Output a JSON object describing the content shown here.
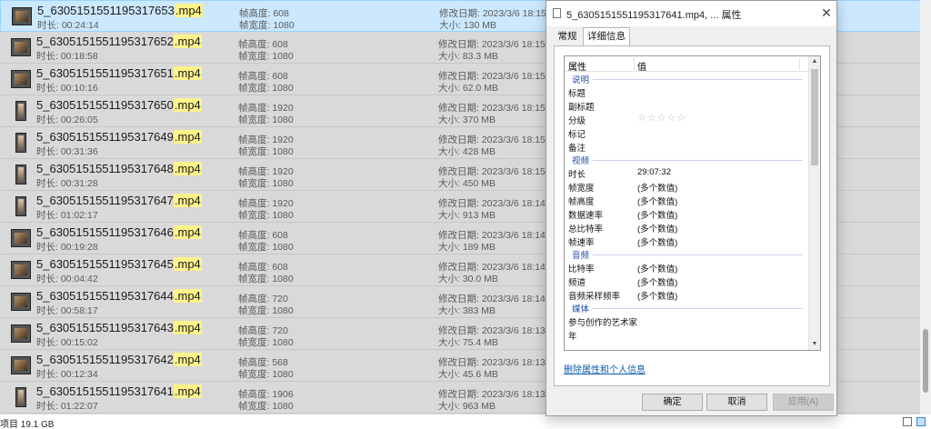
{
  "list": {
    "rows": [
      {
        "name": "5_6305151551195317653",
        "ext": ".mp4",
        "duration": "时长: 00:24:14",
        "height": "帧高度: 608",
        "width": "帧宽度: 1080",
        "modified": "修改日期: 2023/3/6 18:15",
        "size": "大小: 130 MB",
        "selected": true,
        "thumb": "landscape"
      },
      {
        "name": "5_6305151551195317652",
        "ext": ".mp4",
        "duration": "时长: 00:18:58",
        "height": "帧高度: 608",
        "width": "帧宽度: 1080",
        "modified": "修改日期: 2023/3/6 18:15",
        "size": "大小: 83.3 MB",
        "thumb": "landscape"
      },
      {
        "name": "5_6305151551195317651",
        "ext": ".mp4",
        "duration": "时长: 00:10:16",
        "height": "帧高度: 608",
        "width": "帧宽度: 1080",
        "modified": "修改日期: 2023/3/6 18:15",
        "size": "大小: 62.0 MB",
        "thumb": "landscape"
      },
      {
        "name": "5_6305151551195317650",
        "ext": ".mp4",
        "duration": "时长: 00:26:05",
        "height": "帧高度: 1920",
        "width": "帧宽度: 1080",
        "modified": "修改日期: 2023/3/6 18:15",
        "size": "大小: 370 MB",
        "thumb": "portrait"
      },
      {
        "name": "5_6305151551195317649",
        "ext": ".mp4",
        "duration": "时长: 00:31:36",
        "height": "帧高度: 1920",
        "width": "帧宽度: 1080",
        "modified": "修改日期: 2023/3/6 18:15",
        "size": "大小: 428 MB",
        "thumb": "portrait"
      },
      {
        "name": "5_6305151551195317648",
        "ext": ".mp4",
        "duration": "时长: 00:31:28",
        "height": "帧高度: 1920",
        "width": "帧宽度: 1080",
        "modified": "修改日期: 2023/3/6 18:15",
        "size": "大小: 450 MB",
        "thumb": "portrait"
      },
      {
        "name": "5_6305151551195317647",
        "ext": ".mp4",
        "duration": "时长: 01:02:17",
        "height": "帧高度: 1920",
        "width": "帧宽度: 1080",
        "modified": "修改日期: 2023/3/6 18:14",
        "size": "大小: 913 MB",
        "thumb": "portrait"
      },
      {
        "name": "5_6305151551195317646",
        "ext": ".mp4",
        "duration": "时长: 00:19:28",
        "height": "帧高度: 608",
        "width": "帧宽度: 1080",
        "modified": "修改日期: 2023/3/6 18:14",
        "size": "大小: 189 MB",
        "thumb": "landscape"
      },
      {
        "name": "5_6305151551195317645",
        "ext": ".mp4",
        "duration": "时长: 00:04:42",
        "height": "帧高度: 608",
        "width": "帧宽度: 1080",
        "modified": "修改日期: 2023/3/6 18:14",
        "size": "大小: 30.0 MB",
        "thumb": "landscape"
      },
      {
        "name": "5_6305151551195317644",
        "ext": ".mp4",
        "duration": "时长: 00:58:17",
        "height": "帧高度: 720",
        "width": "帧宽度: 1080",
        "modified": "修改日期: 2023/3/6 18:14",
        "size": "大小: 383 MB",
        "thumb": "landscape"
      },
      {
        "name": "5_6305151551195317643",
        "ext": ".mp4",
        "duration": "时长: 00:15:02",
        "height": "帧高度: 720",
        "width": "帧宽度: 1080",
        "modified": "修改日期: 2023/3/6 18:13",
        "size": "大小: 75.4 MB",
        "thumb": "landscape"
      },
      {
        "name": "5_6305151551195317642",
        "ext": ".mp4",
        "duration": "时长: 00:12:34",
        "height": "帧高度: 568",
        "width": "帧宽度: 1080",
        "modified": "修改日期: 2023/3/6 18:13",
        "size": "大小: 45.6 MB",
        "thumb": "landscape"
      },
      {
        "name": "5_6305151551195317641",
        "ext": ".mp4",
        "duration": "时长: 01:22:07",
        "height": "帧高度: 1906",
        "width": "帧宽度: 1080",
        "modified": "修改日期: 2023/3/6 18:13",
        "size": "大小: 963 MB",
        "thumb": "portrait"
      }
    ]
  },
  "status": {
    "text": "项目  19.1 GB"
  },
  "dialog": {
    "title": "5_6305151551195317641.mp4, ... 属性",
    "close": "✕",
    "tabs": [
      "常规",
      "详细信息"
    ],
    "header": {
      "property": "属性",
      "value": "值"
    },
    "sections": [
      {
        "title": "说明",
        "rows": [
          {
            "k": "标题",
            "v": ""
          },
          {
            "k": "副标题",
            "v": ""
          },
          {
            "k": "分级",
            "v": "",
            "stars": "☆☆☆☆☆"
          },
          {
            "k": "标记",
            "v": ""
          },
          {
            "k": "备注",
            "v": ""
          }
        ]
      },
      {
        "title": "视频",
        "rows": [
          {
            "k": "时长",
            "v": "29:07:32"
          },
          {
            "k": "帧宽度",
            "v": "(多个数值)"
          },
          {
            "k": "帧高度",
            "v": "(多个数值)"
          },
          {
            "k": "数据速率",
            "v": "(多个数值)"
          },
          {
            "k": "总比特率",
            "v": "(多个数值)"
          },
          {
            "k": "帧速率",
            "v": "(多个数值)"
          }
        ]
      },
      {
        "title": "音频",
        "rows": [
          {
            "k": "比特率",
            "v": "(多个数值)"
          },
          {
            "k": "频道",
            "v": "(多个数值)"
          },
          {
            "k": "音频采样频率",
            "v": "(多个数值)"
          }
        ]
      },
      {
        "title": "媒体",
        "rows": [
          {
            "k": "参与创作的艺术家",
            "v": ""
          },
          {
            "k": "年",
            "v": ""
          }
        ]
      }
    ],
    "remove_link": "删除属性和个人信息",
    "buttons": {
      "ok": "确定",
      "cancel": "取消",
      "apply": "应用(A)"
    }
  },
  "icons": {
    "file_thumb": "video-thumbnail-icon",
    "dialog": "properties-icon"
  }
}
